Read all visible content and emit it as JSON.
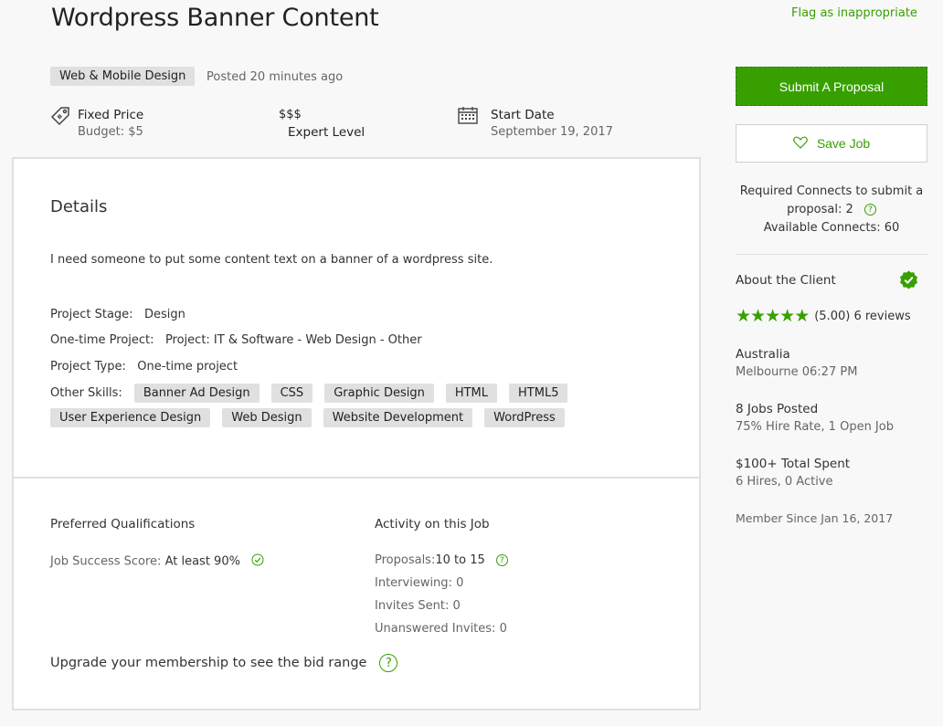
{
  "job": {
    "title": "Wordpress Banner Content",
    "flag_label": "Flag as inappropriate",
    "category": "Web & Mobile Design",
    "posted": "Posted 20 minutes ago",
    "price_type": "Fixed Price",
    "budget": "Budget: $5",
    "level_symbol": "$$$",
    "level": "Expert Level",
    "start_label": "Start Date",
    "start_date": "September 19, 2017"
  },
  "details": {
    "heading": "Details",
    "description": "I need someone to put some content text on a banner of a wordpress site.",
    "stage_label": "Project Stage:",
    "stage_value": "Design",
    "onetime_label": "One-time Project:",
    "onetime_value": "Project: IT & Software - Web Design - Other",
    "type_label": "Project Type:",
    "type_value": "One-time project",
    "skills_label": "Other Skills:",
    "skills": [
      "Banner Ad Design",
      "CSS",
      "Graphic Design",
      "HTML",
      "HTML5",
      "User Experience Design",
      "Web Design",
      "Website Development",
      "WordPress"
    ]
  },
  "qualifications": {
    "heading": "Preferred Qualifications",
    "jss_label": "Job Success Score:",
    "jss_value": "At least 90%"
  },
  "activity": {
    "heading": "Activity on this Job",
    "proposals_label": "Proposals:",
    "proposals_value": "10 to 15",
    "interviewing": "Interviewing: 0",
    "invites": "Invites Sent: 0",
    "unanswered": "Unanswered Invites: 0"
  },
  "upgrade_text": "Upgrade your membership to see the bid range",
  "sidebar": {
    "submit_label": "Submit A Proposal",
    "save_label": "Save Job",
    "connects_line1": "Required Connects to submit a",
    "connects_line2": "proposal: 2",
    "connects_line3": "Available Connects: 60",
    "about_label": "About the Client",
    "rating": 5.0,
    "rating_text": "(5.00) 6 reviews",
    "country": "Australia",
    "city_time": "Melbourne 06:27 PM",
    "jobs_posted": "8 Jobs Posted",
    "hire_rate": "75% Hire Rate, 1 Open Job",
    "total_spent": "$100+ Total Spent",
    "hires": "6 Hires, 0 Active",
    "member_since": "Member Since Jan 16, 2017"
  },
  "colors": {
    "accent": "#37a000",
    "tag_bg": "#e0e0e0",
    "muted": "#656565"
  }
}
